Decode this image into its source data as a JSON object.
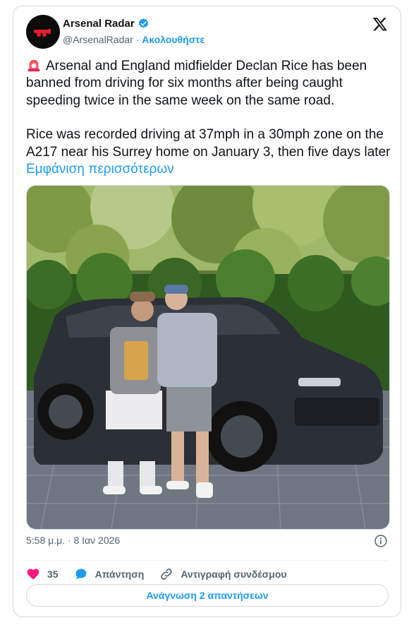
{
  "author": {
    "name": "Arsenal Radar",
    "handle": "@ArsenalRadar",
    "separator": "·",
    "follow_label": "Ακολουθήστε"
  },
  "tweet": {
    "paragraph1": "Arsenal and England midfielder Declan Rice has been banned from driving for six months after being caught speeding twice in the same week on the same road.",
    "paragraph2": "Rice was recorded driving at 37mph in a 30mph zone on the A217 near his Surrey home on January 3, then five days later",
    "show_more": "Εμφάνιση περισσότερων",
    "timestamp": "5:58 μ.μ. · 8 Ιαν 2026"
  },
  "actions": {
    "like_count": "35",
    "reply_label": "Απάντηση",
    "copy_link_label": "Αντιγραφή συνδέσμου"
  },
  "read_replies_label": "Ανάγνωση 2 απαντήσεων",
  "colors": {
    "accent": "#1d9bf0",
    "like": "#f91880",
    "muted": "#536471"
  }
}
